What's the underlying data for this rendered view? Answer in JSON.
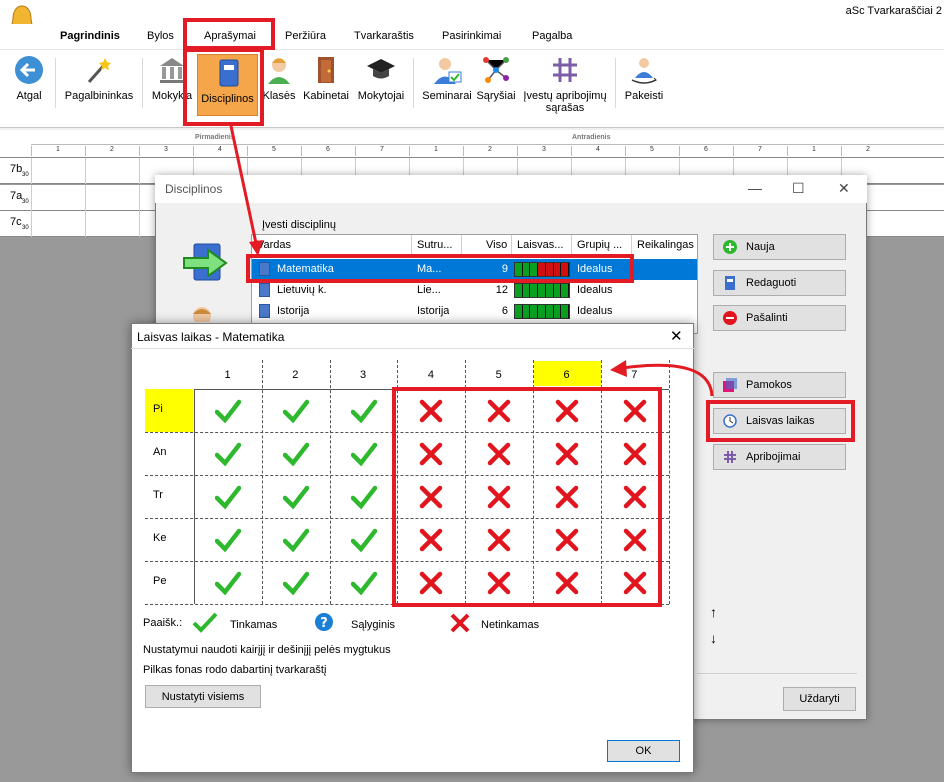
{
  "app": {
    "title": "aSc Tvarkaraščiai 2"
  },
  "menu": {
    "tabs": [
      "Pagrindinis",
      "Bylos",
      "Aprašymai",
      "Peržiūra",
      "Tvarkaraštis",
      "Pasirinkimai",
      "Pagalba"
    ]
  },
  "ribbon": {
    "back": "Atgal",
    "wizard": "Pagalbininkas",
    "schools": "Mokykla",
    "subjects": "Disciplinos",
    "classes": "Klasės",
    "rooms": "Kabinetai",
    "teachers": "Mokytojai",
    "seminars": "Seminarai",
    "relations": "Sąryšiai",
    "constraints_l1": "Įvestų apribojimų",
    "constraints_l2": "sąrašas",
    "changes": "Pakeisti"
  },
  "timetable": {
    "days": [
      "Pirmadienis",
      "Antradienis"
    ],
    "periods": [
      "1",
      "2",
      "3",
      "4",
      "5",
      "6",
      "7",
      "1",
      "2",
      "3",
      "4",
      "5",
      "6",
      "7",
      "1",
      "2"
    ],
    "rows": [
      {
        "name": "7b",
        "sub": "30"
      },
      {
        "name": "7a",
        "sub": "30"
      },
      {
        "name": "7c",
        "sub": "30"
      }
    ]
  },
  "disciplines_window": {
    "title": "Disciplinos",
    "caption": "Įvesti disciplinų",
    "columns": [
      "Vardas",
      "Sutru...",
      "Viso",
      "Laisvas...",
      "Grupių ...",
      "Reikalingas r"
    ],
    "rows": [
      {
        "name": "Matematika",
        "short": "Ma...",
        "total": "9",
        "group": "Idealus",
        "selected": true
      },
      {
        "name": "Lietuvių k.",
        "short": "Lie...",
        "total": "12",
        "group": "Idealus",
        "selected": false
      },
      {
        "name": "Istorija",
        "short": "Istorija",
        "total": "6",
        "group": "Idealus",
        "selected": false
      }
    ],
    "buttons": {
      "new": "Nauja",
      "edit": "Redaguoti",
      "delete": "Pašalinti",
      "lessons": "Pamokos",
      "free_time": "Laisvas laikas",
      "constraints": "Apribojimai",
      "close": "Uždaryti"
    },
    "arrows": [
      "↑",
      "↓"
    ]
  },
  "free_time_dialog": {
    "title": "Laisvas laikas - Matematika",
    "periods": [
      "1",
      "2",
      "3",
      "4",
      "5",
      "6",
      "7"
    ],
    "days": [
      "Pi",
      "An",
      "Tr",
      "Ke",
      "Pe"
    ],
    "legend": {
      "prefix": "Paaišk.:",
      "ok": "Tinkamas",
      "conditional": "Sąlyginis",
      "bad": "Netinkamas"
    },
    "hint1": "Nustatymui naudoti kairįjį ir dešinįjį pelės mygtukus",
    "hint2": "Pilkas fonas rodo dabartinį tvarkaraštį",
    "set_all": "Nustatyti visiems",
    "ok": "OK"
  },
  "colors": {
    "accent": "#0078d7",
    "highlight": "#ffff00",
    "annotation": "#e21b24",
    "check": "#2eb82e",
    "cross": "#e0151d"
  }
}
